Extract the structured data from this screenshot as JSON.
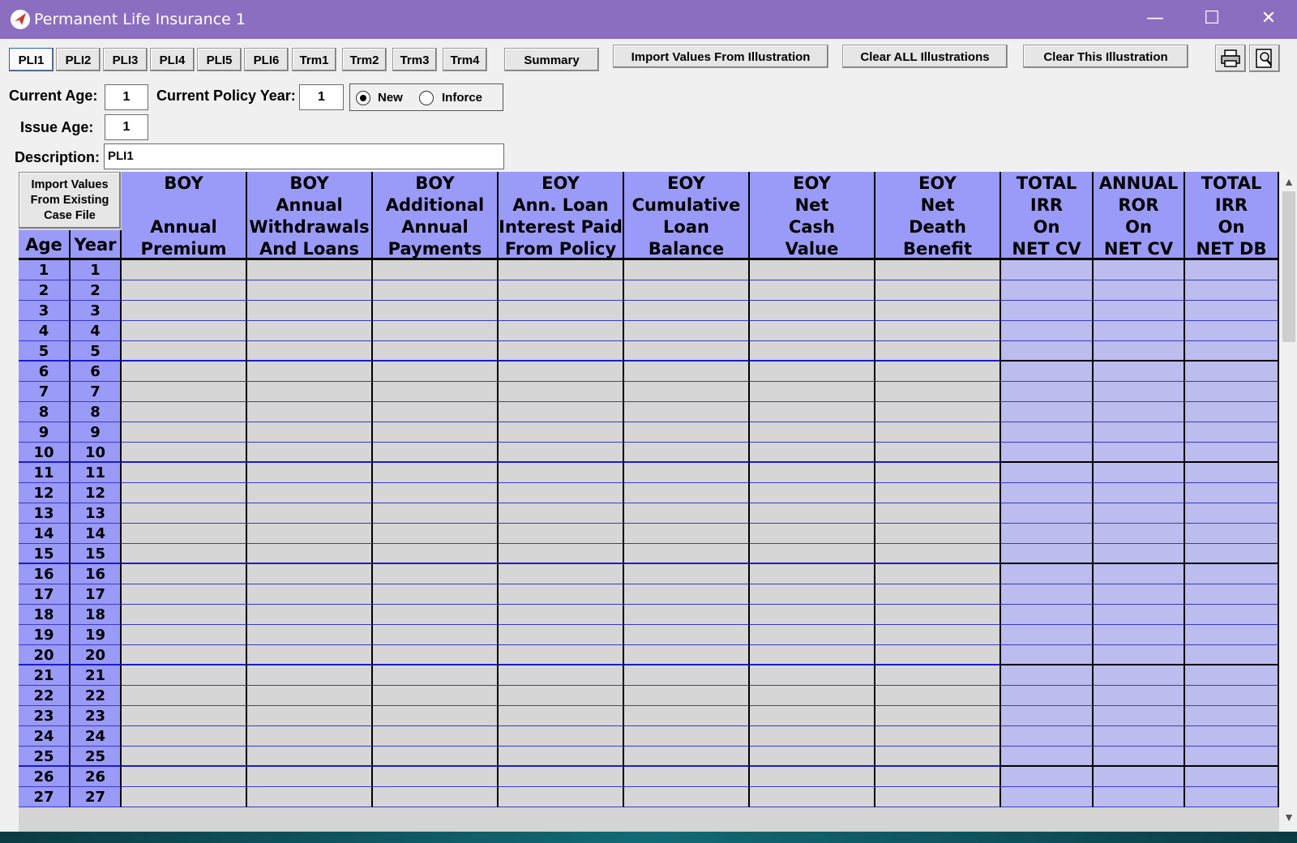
{
  "window": {
    "title": "Permanent Life Insurance 1",
    "controls": {
      "minimize": "—",
      "maximize": "☐",
      "close": "✕"
    }
  },
  "toolbar": {
    "tabs": [
      "PLI1",
      "PLI2",
      "PLI3",
      "PLI4",
      "PLI5",
      "PLI6",
      "Trm1",
      "Trm2",
      "Trm3",
      "Trm4"
    ],
    "active_tab": "PLI1",
    "summary": "Summary",
    "import_values": "Import Values From Illustration",
    "clear_all": "Clear ALL Illustrations",
    "clear_this": "Clear This Illustration",
    "print_icon": "printer-icon",
    "preview_icon": "print-preview-icon"
  },
  "form": {
    "current_age_label": "Current Age:",
    "current_age": "1",
    "policy_year_label": "Current Policy Year:",
    "policy_year": "1",
    "status_options": [
      "New",
      "Inforce"
    ],
    "status_selected": "New",
    "issue_age_label": "Issue Age:",
    "issue_age": "1",
    "description_label": "Description:",
    "description": "PLI1"
  },
  "grid": {
    "import_case_file": [
      "Import Values",
      "From Existing",
      "Case File"
    ],
    "age_header": "Age",
    "year_header": "Year",
    "columns": [
      [
        "BOY",
        "",
        "Annual",
        "Premium"
      ],
      [
        "BOY",
        "Annual",
        "Withdrawals",
        "And Loans"
      ],
      [
        "BOY",
        "Additional",
        "Annual",
        "Payments"
      ],
      [
        "EOY",
        "Ann. Loan",
        "Interest Paid",
        "From Policy"
      ],
      [
        "EOY",
        "Cumulative",
        "Loan",
        "Balance"
      ],
      [
        "EOY",
        "Net",
        "Cash",
        "Value"
      ],
      [
        "EOY",
        "Net",
        "Death",
        "Benefit"
      ],
      [
        "TOTAL",
        "IRR",
        "On",
        "NET CV"
      ],
      [
        "ANNUAL",
        "ROR",
        "On",
        "NET CV"
      ],
      [
        "TOTAL",
        "IRR",
        "On",
        "NET DB"
      ]
    ],
    "rows": [
      {
        "age": "1",
        "year": "1"
      },
      {
        "age": "2",
        "year": "2"
      },
      {
        "age": "3",
        "year": "3"
      },
      {
        "age": "4",
        "year": "4"
      },
      {
        "age": "5",
        "year": "5"
      },
      {
        "age": "6",
        "year": "6"
      },
      {
        "age": "7",
        "year": "7"
      },
      {
        "age": "8",
        "year": "8"
      },
      {
        "age": "9",
        "year": "9"
      },
      {
        "age": "10",
        "year": "10"
      },
      {
        "age": "11",
        "year": "11"
      },
      {
        "age": "12",
        "year": "12"
      },
      {
        "age": "13",
        "year": "13"
      },
      {
        "age": "14",
        "year": "14"
      },
      {
        "age": "15",
        "year": "15"
      },
      {
        "age": "16",
        "year": "16"
      },
      {
        "age": "17",
        "year": "17"
      },
      {
        "age": "18",
        "year": "18"
      },
      {
        "age": "19",
        "year": "19"
      },
      {
        "age": "20",
        "year": "20"
      },
      {
        "age": "21",
        "year": "21"
      },
      {
        "age": "22",
        "year": "22"
      },
      {
        "age": "23",
        "year": "23"
      },
      {
        "age": "24",
        "year": "24"
      },
      {
        "age": "25",
        "year": "25"
      },
      {
        "age": "26",
        "year": "26"
      },
      {
        "age": "27",
        "year": "27"
      }
    ]
  },
  "colors": {
    "titlebar": "#8c6ec0",
    "header": "#9a9af8",
    "input_cell": "#d6d6d6",
    "calc_cell": "#bcbcee"
  }
}
